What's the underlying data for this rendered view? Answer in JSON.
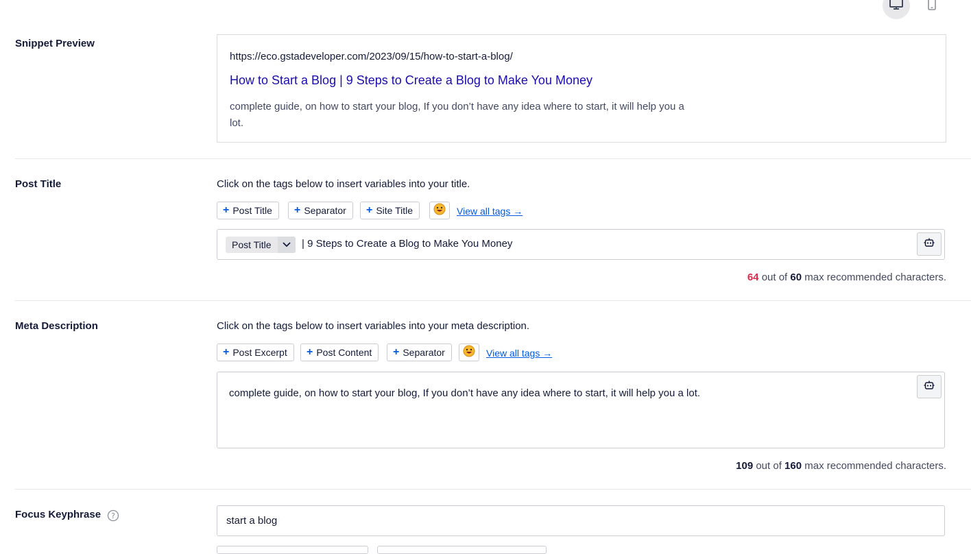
{
  "device_toggle": {
    "desktop_icon": "desktop-icon",
    "mobile_icon": "mobile-icon"
  },
  "snippet": {
    "label": "Snippet Preview",
    "url": "https://eco.gstadeveloper.com/2023/09/15/how-to-start-a-blog/",
    "title": "How to Start a Blog | 9 Steps to Create a Blog to Make You Money",
    "description": "complete guide, on how to start your blog, If you don’t have any idea where to start, it will help you a lot.",
    "title_color": "#1a0dab"
  },
  "post_title": {
    "label": "Post Title",
    "help": "Click on the tags below to insert variables into your title.",
    "tags": [
      "Post Title",
      "Separator",
      "Site Title"
    ],
    "view_all": "View all tags →",
    "chip": "Post Title",
    "value_rest": "| 9 Steps to Create a Blog to Make You Money",
    "count": "64",
    "count_color": "#df2a4a",
    "count_mid": "out of",
    "max": "60",
    "count_suffix": "max recommended characters."
  },
  "meta_description": {
    "label": "Meta Description",
    "help": "Click on the tags below to insert variables into your meta description.",
    "tags": [
      "Post Excerpt",
      "Post Content",
      "Separator"
    ],
    "view_all": "View all tags →",
    "value": "complete guide, on how to start your blog, If you don’t have any idea where to start, it will help you a lot.",
    "count": "109",
    "count_mid": "out of",
    "max": "160",
    "count_suffix": "max recommended characters."
  },
  "focus_keyphrase": {
    "label": "Focus Keyphrase",
    "value": "start a blog"
  },
  "colors": {
    "accent": "#005ae0",
    "text": "#141b38",
    "muted": "#434960",
    "error": "#df2a4a"
  }
}
